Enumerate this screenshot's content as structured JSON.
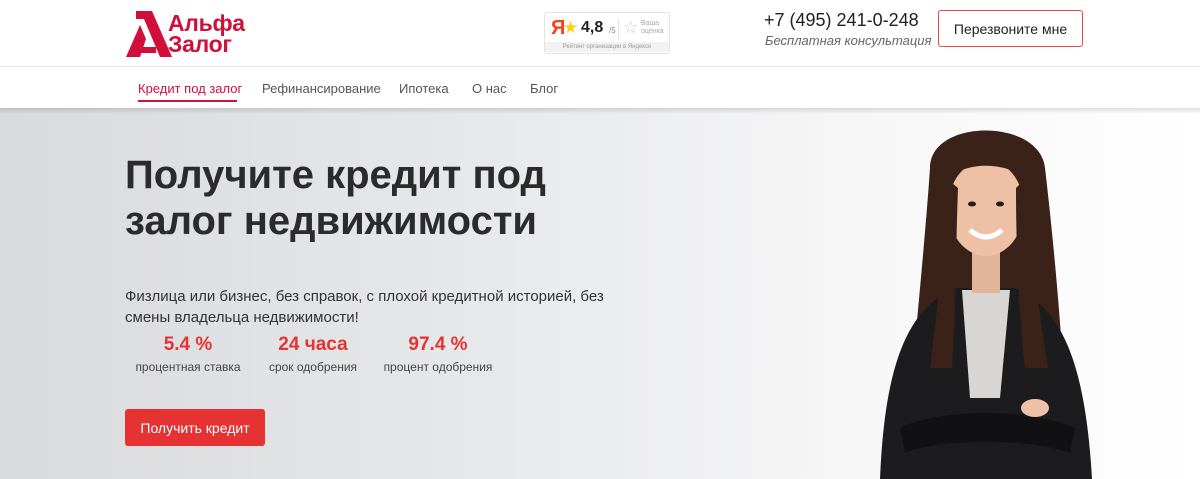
{
  "logo": {
    "line1": "Альфа",
    "line2": "Залог",
    "color": "#d0103a"
  },
  "rating": {
    "score": "4,8",
    "outof": "/5",
    "your_rating": "Ваша оценка",
    "caption": "Рейтинг организации в Яндексе",
    "ya_letter": "Я"
  },
  "contact": {
    "phone": "+7 (495) 241-0-248",
    "subtitle": "Бесплатная консультация"
  },
  "header": {
    "callback_label": "Перезвоните мне"
  },
  "nav": {
    "items": [
      {
        "label": "Кредит под залог"
      },
      {
        "label": "Рефинансирование"
      },
      {
        "label": "Ипотека"
      },
      {
        "label": "О нас"
      },
      {
        "label": "Блог"
      }
    ],
    "active_index": 0,
    "accent": "#d0103a"
  },
  "hero": {
    "title_line1": "Получите кредит под",
    "title_line2": "залог недвижимости",
    "subtitle": "Физлица или бизнес, без справок, с плохой кредитной историей, без смены владельца недвижимости!",
    "stats": [
      {
        "value": "5.4 %",
        "label": "процентная ставка"
      },
      {
        "value": "24 часа",
        "label": "срок одобрения"
      },
      {
        "value": "97.4 %",
        "label": "процент одобрения"
      }
    ],
    "cta_label": "Получить кредит",
    "accent": "#e63232"
  }
}
